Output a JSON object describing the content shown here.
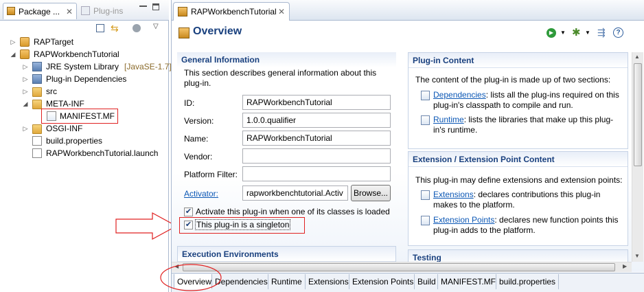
{
  "left_panel": {
    "tabs": [
      {
        "label": "Package ..."
      },
      {
        "label": "Plug-ins"
      }
    ],
    "tree": [
      {
        "label": "RAPTarget"
      },
      {
        "label": "RAPWorkbenchTutorial"
      },
      {
        "label": "JRE System Library",
        "decoration": "[JavaSE-1.7]"
      },
      {
        "label": "Plug-in Dependencies"
      },
      {
        "label": "src"
      },
      {
        "label": "META-INF"
      },
      {
        "label": "MANIFEST.MF"
      },
      {
        "label": "OSGI-INF"
      },
      {
        "label": "build.properties"
      },
      {
        "label": "RAPWorkbenchTutorial.launch"
      }
    ]
  },
  "editor": {
    "tab_label": "RAPWorkbenchTutorial",
    "page_title": "Overview",
    "general": {
      "title": "General Information",
      "description": "This section describes general information about this plug-in.",
      "id_label": "ID:",
      "id_value": "RAPWorkbenchTutorial",
      "version_label": "Version:",
      "version_value": "1.0.0.qualifier",
      "name_label": "Name:",
      "name_value": "RAPWorkbenchTutorial",
      "vendor_label": "Vendor:",
      "vendor_value": "",
      "platform_label": "Platform Filter:",
      "platform_value": "",
      "activator_label": "Activator:",
      "activator_value": "rapworkbenchtutorial.Activ",
      "browse_label": "Browse...",
      "check_activate": "Activate this plug-in when one of its classes is loaded",
      "check_singleton": "This plug-in is a singleton"
    },
    "exec_env_title": "Execution Environments",
    "plugin_content": {
      "title": "Plug-in Content",
      "intro": "The content of the plug-in is made up of two sections:",
      "dependencies_link": "Dependencies",
      "dependencies_text": ": lists all the plug-ins required on this plug-in's classpath to compile and run.",
      "runtime_link": "Runtime",
      "runtime_text": ": lists the libraries that make up this plug-in's runtime."
    },
    "extension_content": {
      "title": "Extension / Extension Point Content",
      "intro": "This plug-in may define extensions and extension points:",
      "extensions_link": "Extensions",
      "extensions_text": ": declares contributions this plug-in makes to the platform.",
      "points_link": "Extension Points",
      "points_text": ": declares new function points this plug-in adds to the platform."
    },
    "testing_title": "Testing",
    "bottom_tabs": [
      "Overview",
      "Dependencies",
      "Runtime",
      "Extensions",
      "Extension Points",
      "Build",
      "MANIFEST.MF",
      "build.properties"
    ]
  },
  "colors": {
    "annotation_red": "#e02020",
    "heading_blue": "#19407e",
    "link_blue": "#0b57b5"
  }
}
